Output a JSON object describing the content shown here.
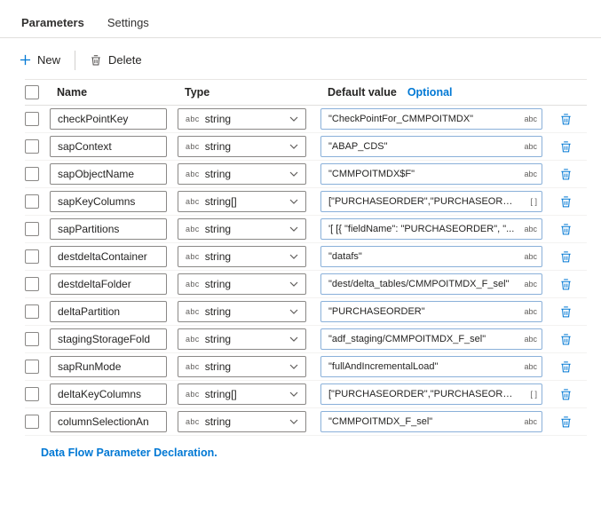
{
  "tabs": {
    "parameters": "Parameters",
    "settings": "Settings"
  },
  "toolbar": {
    "new": "New",
    "delete": "Delete"
  },
  "header": {
    "name": "Name",
    "type": "Type",
    "default_value": "Default value",
    "optional": "Optional"
  },
  "rows": [
    {
      "name": "checkPointKey",
      "type_prefix": "abc",
      "type": "string",
      "value": "\"CheckPointFor_CMMPOITMDX\"",
      "value_badge": "abc"
    },
    {
      "name": "sapContext",
      "type_prefix": "abc",
      "type": "string",
      "value": "\"ABAP_CDS\"",
      "value_badge": "abc"
    },
    {
      "name": "sapObjectName",
      "type_prefix": "abc",
      "type": "string",
      "value": "\"CMMPOITMDX$F\"",
      "value_badge": "abc"
    },
    {
      "name": "sapKeyColumns",
      "type_prefix": "abc",
      "type": "string[]",
      "value": "[\"PURCHASEORDER\",\"PURCHASEORDE...",
      "value_badge": "[ ]"
    },
    {
      "name": "sapPartitions",
      "type_prefix": "abc",
      "type": "string",
      "value": "'[ [{ \"fieldName\": \"PURCHASEORDER\", \"...",
      "value_badge": "abc"
    },
    {
      "name": "destdeltaContainer",
      "type_prefix": "abc",
      "type": "string",
      "value": "\"datafs\"",
      "value_badge": "abc"
    },
    {
      "name": "destdeltaFolder",
      "type_prefix": "abc",
      "type": "string",
      "value": "\"dest/delta_tables/CMMPOITMDX_F_sel\"",
      "value_badge": "abc"
    },
    {
      "name": "deltaPartition",
      "type_prefix": "abc",
      "type": "string",
      "value": "\"PURCHASEORDER\"",
      "value_badge": "abc"
    },
    {
      "name": "stagingStorageFold",
      "type_prefix": "abc",
      "type": "string",
      "value": "\"adf_staging/CMMPOITMDX_F_sel\"",
      "value_badge": "abc"
    },
    {
      "name": "sapRunMode",
      "type_prefix": "abc",
      "type": "string",
      "value": "\"fullAndIncrementalLoad\"",
      "value_badge": "abc"
    },
    {
      "name": "deltaKeyColumns",
      "type_prefix": "abc",
      "type": "string[]",
      "value": "[\"PURCHASEORDER\",\"PURCHASEORDE...",
      "value_badge": "[ ]"
    },
    {
      "name": "columnSelectionAn",
      "type_prefix": "abc",
      "type": "string",
      "value": "\"CMMPOITMDX_F_sel\"",
      "value_badge": "abc"
    }
  ],
  "footer": {
    "caption": "Data Flow Parameter Declaration."
  },
  "colors": {
    "accent": "#0078d4"
  },
  "icons": {
    "plus": "plus-icon",
    "trash": "trash-icon",
    "chevron": "chevron-down-icon"
  }
}
